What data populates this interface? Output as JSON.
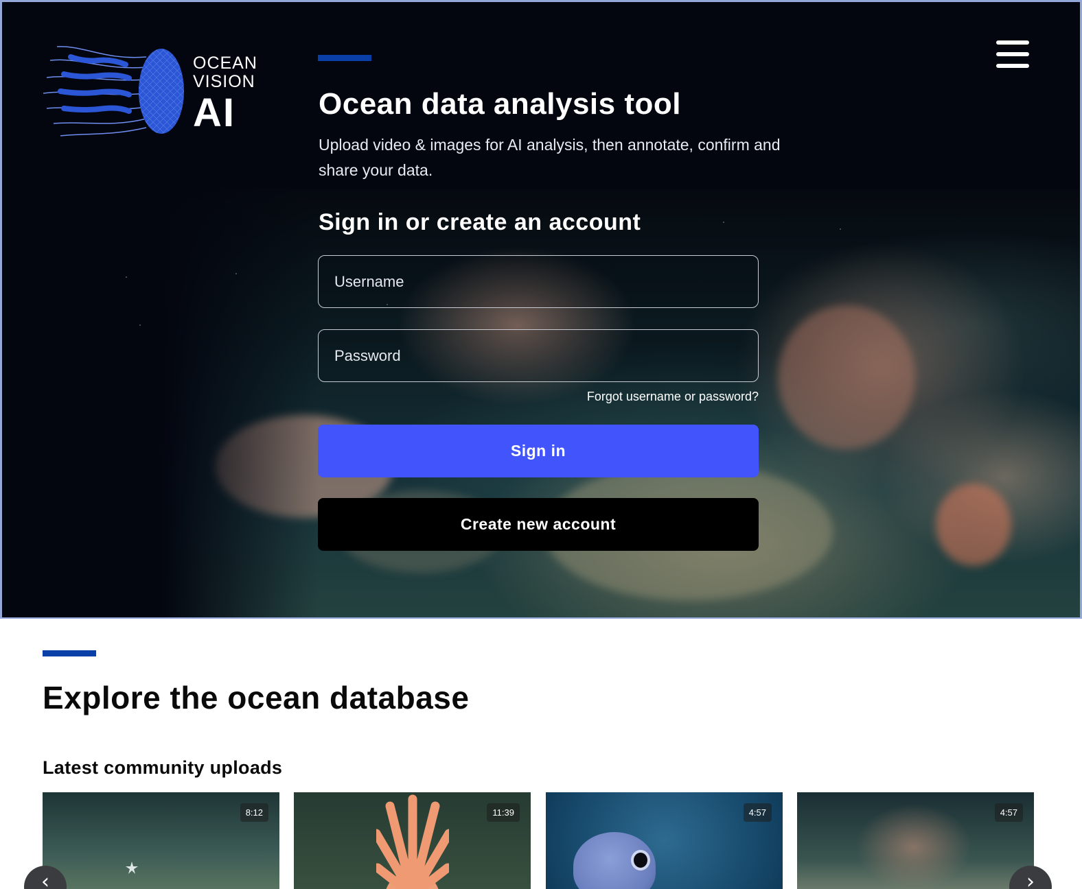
{
  "header": {
    "logo": {
      "line1": "OCEAN",
      "line2": "VISION",
      "line3": "AI",
      "icon": "jellyfish-logo"
    },
    "menu_icon": "hamburger-menu-icon"
  },
  "hero": {
    "title": "Ocean data analysis tool",
    "description": "Upload video & images for AI analysis, then annotate, confirm and share your data.",
    "signin_heading": "Sign in or create an account",
    "username": {
      "value": "",
      "placeholder": "Username"
    },
    "password": {
      "value": "",
      "placeholder": "Password"
    },
    "forgot_link": "Forgot username or password?",
    "signin_label": "Sign in",
    "create_label": "Create new account"
  },
  "explore": {
    "title": "Explore the ocean database",
    "uploads_title": "Latest community uploads",
    "uploads": [
      {
        "duration": "8:12"
      },
      {
        "duration": "11:39"
      },
      {
        "duration": "4:57"
      },
      {
        "duration": "4:57"
      }
    ]
  },
  "colors": {
    "accent": "#0a3fa8",
    "signin_button": "#4254fb",
    "create_button": "#000000",
    "hero_background": "#03050f",
    "logo_blue": "#2b56d6"
  }
}
